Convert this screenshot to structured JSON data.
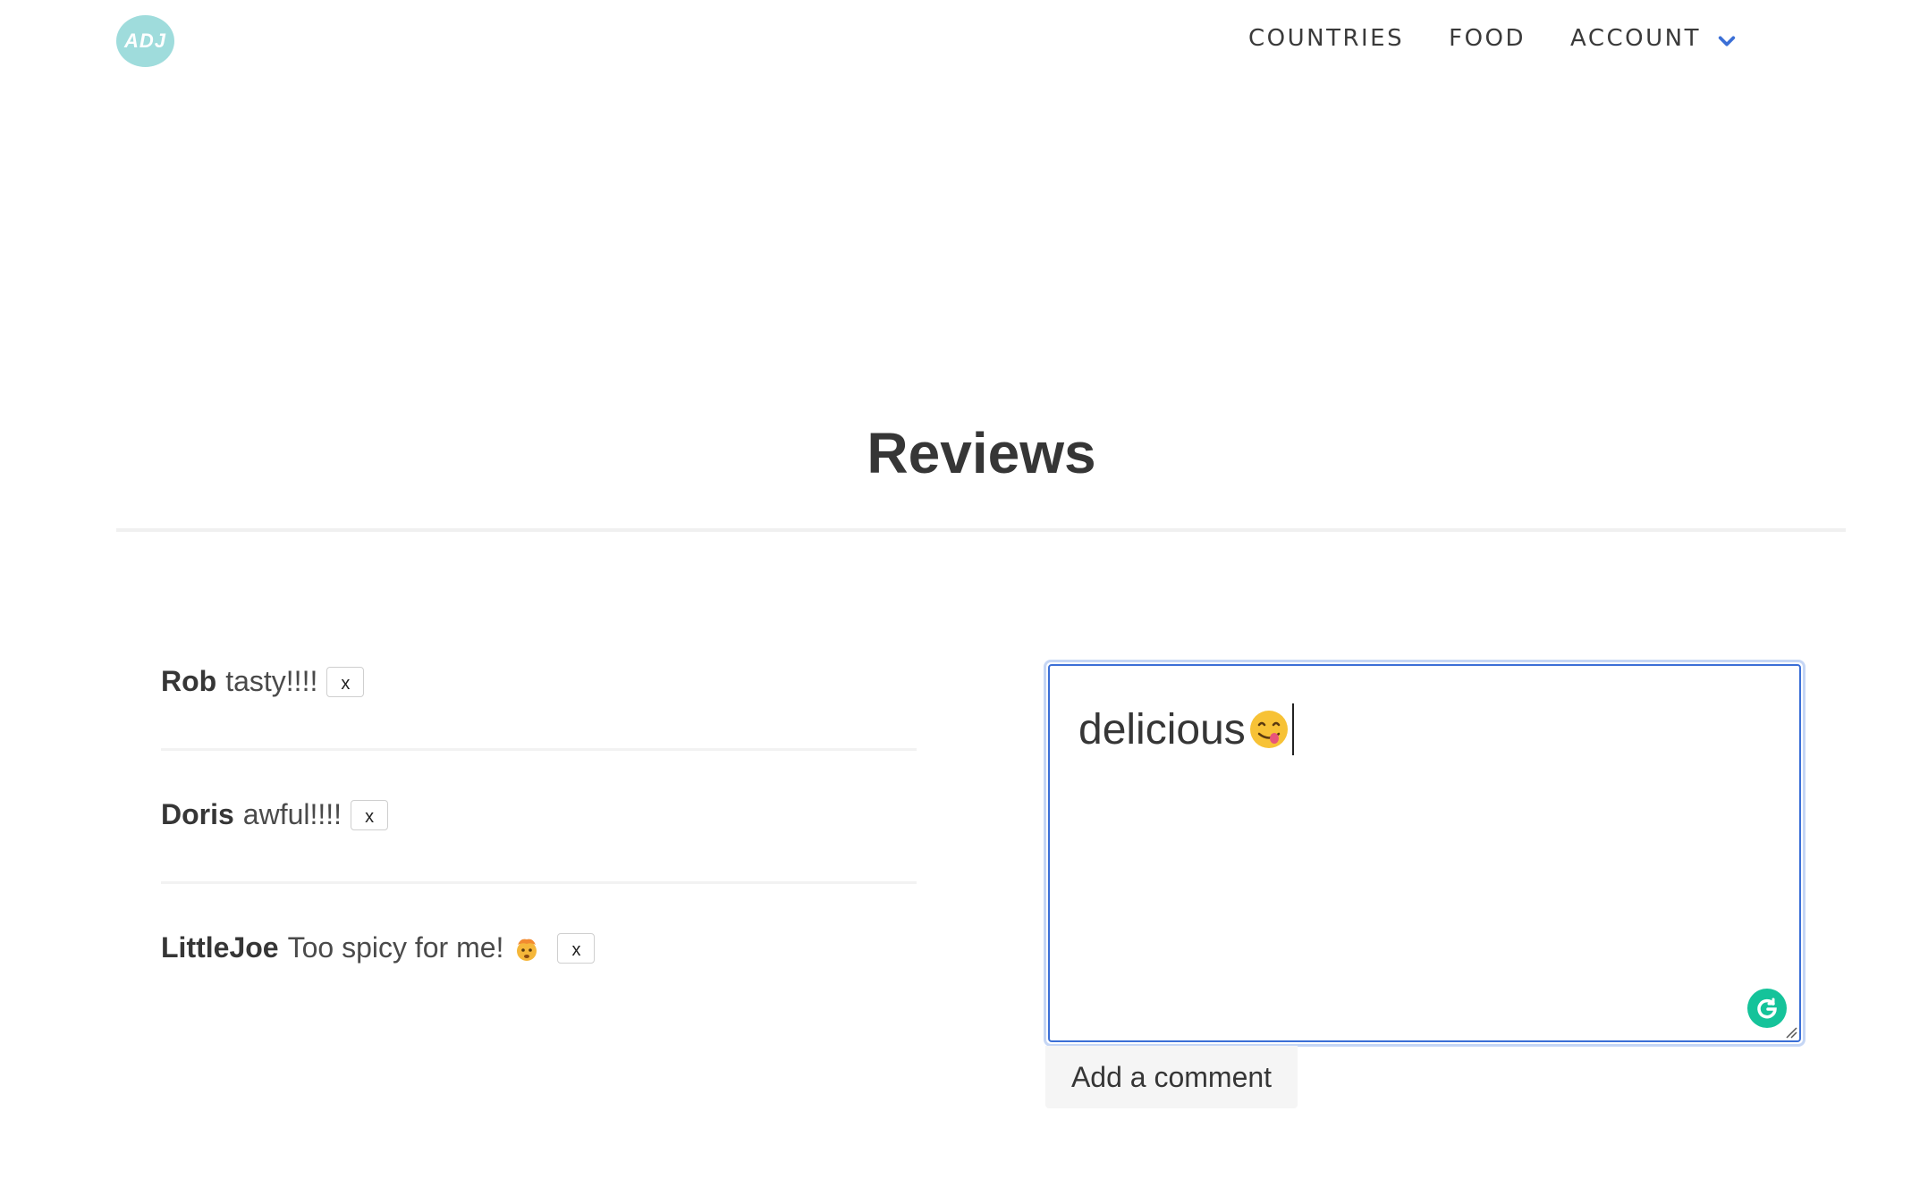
{
  "header": {
    "logo_text": "ADJ",
    "nav": {
      "countries": "COUNTRIES",
      "food": "FOOD",
      "account": "ACCOUNT"
    },
    "accent_color": "#3b6fd6"
  },
  "main": {
    "title": "Reviews",
    "reviews": [
      {
        "author": "Rob",
        "text": "tasty!!!!",
        "delete_label": "x"
      },
      {
        "author": "Doris",
        "text": "awful!!!!",
        "delete_label": "x"
      },
      {
        "author": "LittleJoe",
        "text": "Too spicy for me!",
        "emoji": "exploding-head-icon",
        "delete_label": "x"
      }
    ],
    "comment_box": {
      "value": "delicious",
      "value_emoji": "yum-face-icon",
      "grammarly": "grammarly-icon"
    },
    "add_comment_label": "Add a comment"
  }
}
